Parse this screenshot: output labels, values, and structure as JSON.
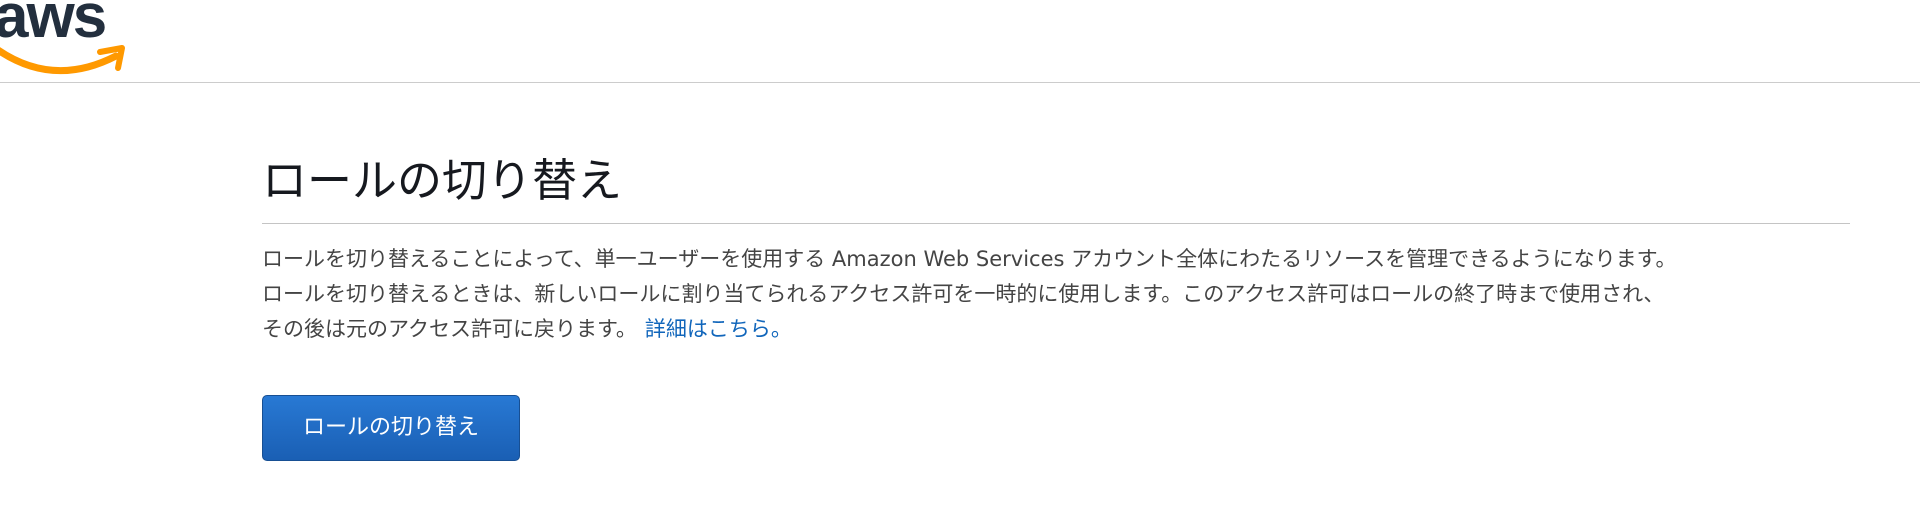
{
  "header": {
    "logo_text": "aws",
    "logo_icon": "aws-smile-arrow",
    "brand_colors": {
      "text": "#232f3e",
      "arrow": "#ff9900"
    }
  },
  "main": {
    "title": "ロールの切り替え",
    "description_lines": [
      "ロールを切り替えることによって、単一ユーザーを使用する Amazon Web Services アカウント全体にわたるリソースを管理できるようになります。",
      "ロールを切り替えるときは、新しいロールに割り当てられるアクセス許可を一時的に使用します。このアクセス許可はロールの終了時まで使用され、",
      "その後は元のアクセス許可に戻ります。"
    ],
    "learn_more_link": "詳細はこちら。",
    "switch_button_label": "ロールの切り替え",
    "colors": {
      "link": "#1166bb",
      "button": "#1f6ac6"
    }
  }
}
